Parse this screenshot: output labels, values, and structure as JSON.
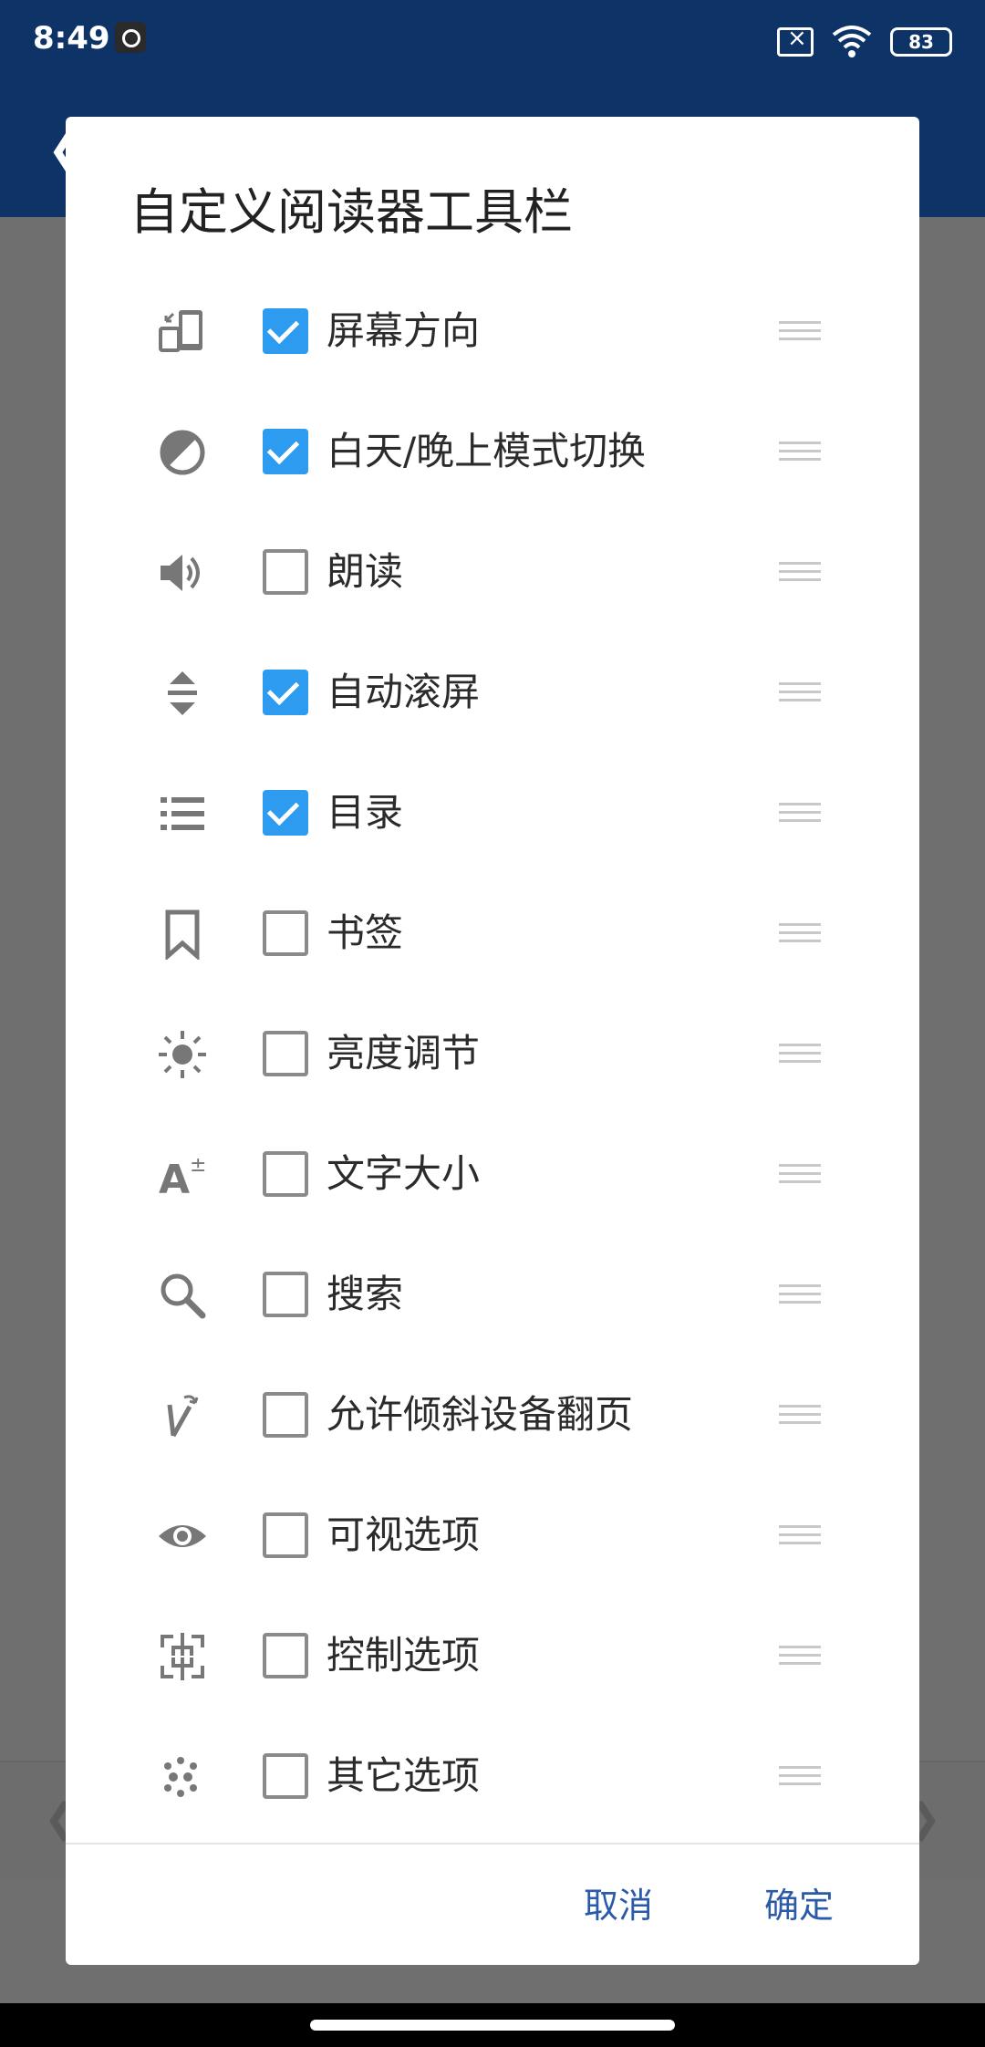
{
  "status": {
    "time": "8:49",
    "battery": "83"
  },
  "dialog": {
    "title": "自定义阅读器工具栏",
    "items": [
      {
        "label": "屏幕方向",
        "checked": true,
        "icon": "screen-rotation-icon"
      },
      {
        "label": "白天/晚上模式切换",
        "checked": true,
        "icon": "contrast-icon"
      },
      {
        "label": "朗读",
        "checked": false,
        "icon": "volume-icon"
      },
      {
        "label": "自动滚屏",
        "checked": true,
        "icon": "auto-scroll-icon"
      },
      {
        "label": "目录",
        "checked": true,
        "icon": "list-icon"
      },
      {
        "label": "书签",
        "checked": false,
        "icon": "bookmark-icon"
      },
      {
        "label": "亮度调节",
        "checked": false,
        "icon": "brightness-icon"
      },
      {
        "label": "文字大小",
        "checked": false,
        "icon": "text-size-icon"
      },
      {
        "label": "搜索",
        "checked": false,
        "icon": "search-icon"
      },
      {
        "label": "允许倾斜设备翻页",
        "checked": false,
        "icon": "tilt-icon"
      },
      {
        "label": "可视选项",
        "checked": false,
        "icon": "eye-icon"
      },
      {
        "label": "控制选项",
        "checked": false,
        "icon": "control-icon"
      },
      {
        "label": "其它选项",
        "checked": false,
        "icon": "dots-icon"
      }
    ],
    "cancel_label": "取消",
    "ok_label": "确定"
  },
  "colors": {
    "accent": "#2c9bf0",
    "button_text": "#2b5aa8",
    "appbar": "#0e3467"
  }
}
